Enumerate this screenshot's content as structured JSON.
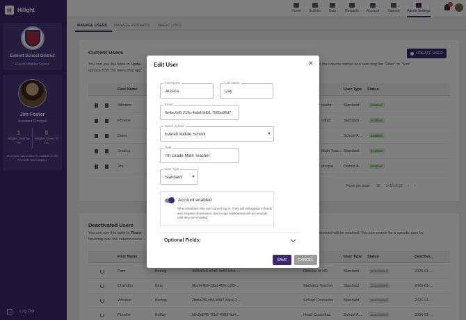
{
  "app": {
    "logo_letter": "H",
    "brand": "Hilight"
  },
  "district": {
    "name": "Everett School District",
    "school": "Everett Middle School"
  },
  "user": {
    "name": "Jim Foster",
    "role": "Assistant Principal",
    "sent": "1",
    "sent_label": "Hilights Sent By You",
    "given": "0",
    "given_label": "Hilights Given To You",
    "points_note": "You have 120 points to redeem in the Rewards Marketplace"
  },
  "sidebar": {
    "logout": "Log Out"
  },
  "nav": {
    "items": [
      {
        "label": "Home"
      },
      {
        "label": "Bulletin"
      },
      {
        "label": "Data"
      },
      {
        "label": "Rewards"
      },
      {
        "label": "Account"
      },
      {
        "label": "Support"
      },
      {
        "label": "Admin Settings"
      }
    ],
    "bell_count": "0"
  },
  "tabs": [
    "MANAGE USERS",
    "MANAGE REWARDS",
    "MAGIC LINKS"
  ],
  "current": {
    "title": "Current Users",
    "desc_prefix": "You can use this table to ",
    "desc_bold": "Upda",
    "desc_rest_left": "options from the menu that app",
    "desc_right": "ering over the column names and selecting the \"Filter\" or \"Sort\"",
    "create_label": "CREATE USER",
    "headers": {
      "first": "First Name",
      "type": "User Type",
      "status": "Status"
    },
    "rows": [
      {
        "first": "Winston",
        "role_tail": "nselor",
        "type": "Standard",
        "status": "Enabled"
      },
      {
        "first": "Phoebe",
        "role_tail": "odian",
        "type": "Standard",
        "status": "Enabled"
      },
      {
        "first": "Diane",
        "role_tail": "",
        "type": "School A...",
        "status": "Enabled"
      },
      {
        "first": "Jessica",
        "role_tail": "Math Teac...",
        "type": "Standard",
        "status": "Enabled"
      },
      {
        "first": "Jim",
        "role_tail": "rincipal",
        "type": "District A...",
        "status": "Enabled"
      }
    ],
    "pager": {
      "rows_label": "Rows per page:",
      "rows_value": "10",
      "range": "1–10 of 19"
    }
  },
  "deactivated": {
    "title": "Deactivated Users",
    "desc_prefix": "You can use this table to ",
    "desc_bold": "React",
    "desc_rest_left": "hovering over the column name",
    "desc_right": "received will be retained. You can search for a specific user by",
    "headers": {
      "first": "First Name",
      "type": "User Type",
      "status": "Status",
      "deact": "Deactiva..."
    },
    "rows": [
      {
        "first": "Pam",
        "last": "Beesly",
        "email": "33f5b0c3-d7d5-4c55-bfc6-...",
        "role": "Director of HR",
        "type": "Standard",
        "status": "Deactivated",
        "date": "2026-01-..."
      },
      {
        "first": "Chandler",
        "last": "Bing",
        "email": "9ba7e9b6-f3bd-4f2e-b2f9-...",
        "role": "Statistics Teacher",
        "type": "Standard",
        "status": "Deactivated",
        "date": "2026-01-..."
      },
      {
        "first": "Winston",
        "last": "Bishop",
        "email": "2fbba2f6-cf5f-4897-84c4-2...",
        "role": "School Counselor",
        "type": "Standard",
        "status": "Deactivated",
        "date": "2026-01-..."
      },
      {
        "first": "Phoebe",
        "last": "Buffay",
        "email": "b6c0d045-70b6-4389-9b4...",
        "role": "Head Custodian",
        "type": "School A...",
        "status": "Deactivated",
        "date": "2026-01-..."
      }
    ]
  },
  "modal": {
    "title": "Edit User",
    "first_label": "First Name",
    "first_value": "Jessica",
    "last_label": "Last Name",
    "last_value": "Day",
    "email_label": "Email",
    "email_value": "0e4ac6d5-219c-4abd-9d91-7585e86d7",
    "school_label": "Select School",
    "school_value": "Everett Middle School",
    "role_label": "Role",
    "role_value": "7th Grade Math Teacher",
    "type_label": "User Type",
    "type_value": "Standard",
    "toggle_label": "Account enabled",
    "toggle_on": true,
    "toggle_help": "When disabled, this user cannot log in. They will still appear in feeds and recipient dropdowns, and in-app notifications will accumulate until they are enabled.",
    "optional_label": "Optional Fields:",
    "save": "SAVE",
    "cancel": "CANCEL"
  },
  "colors": {
    "brand": "#3a2a6e",
    "enabled_bg": "#d8f0d0",
    "overlay": "rgba(0,0,0,0.5)"
  }
}
